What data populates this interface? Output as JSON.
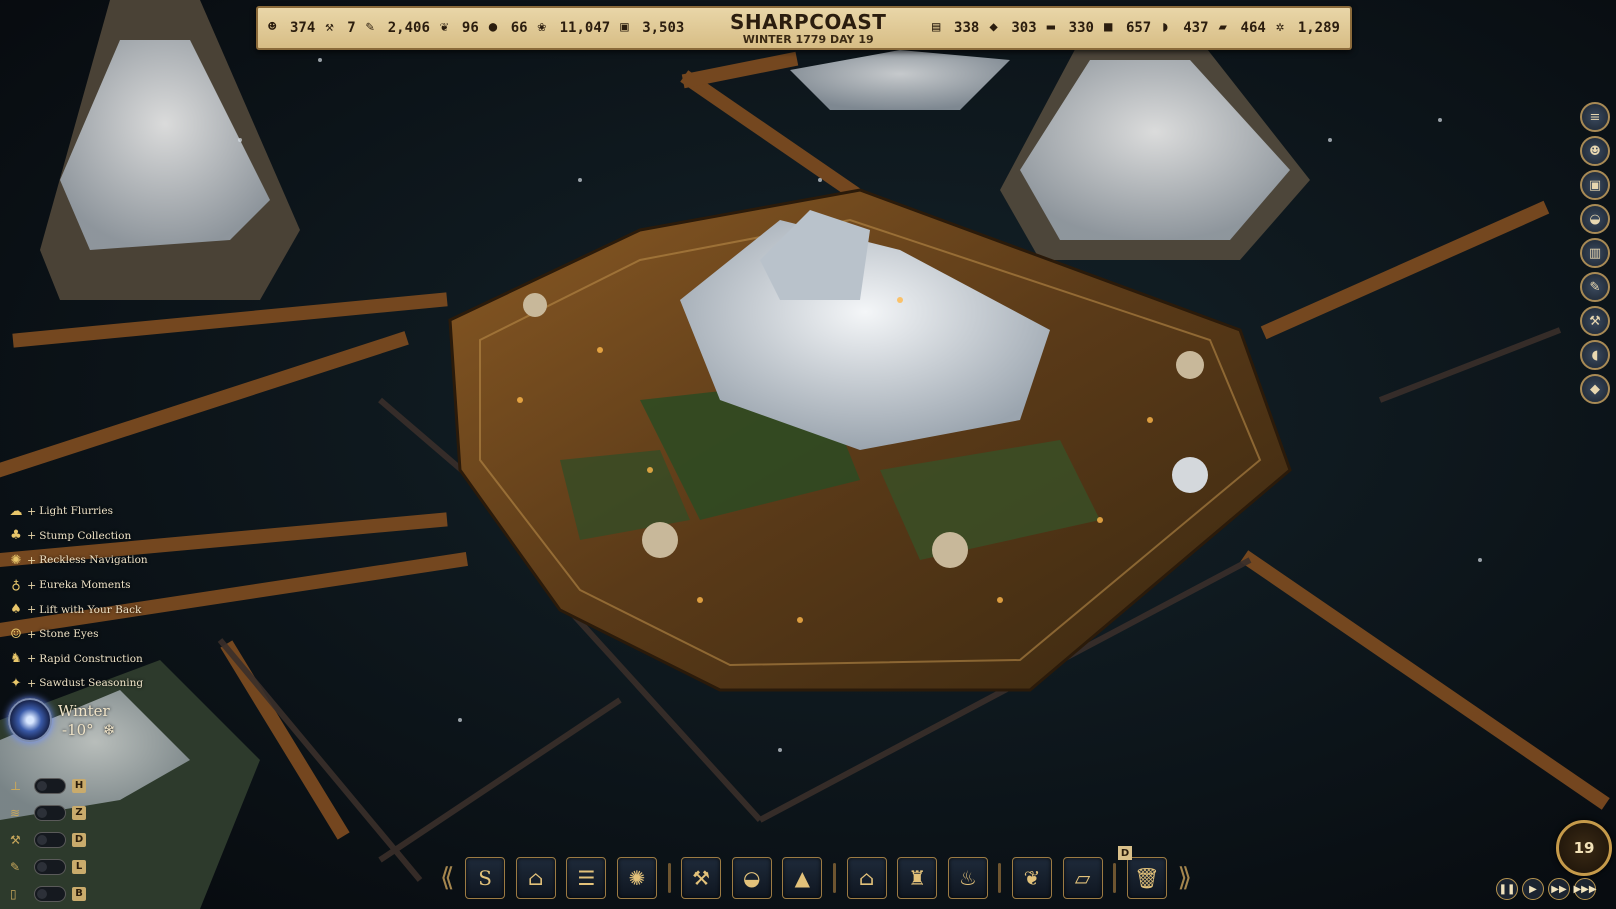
{
  "resources_left": [
    {
      "icon": "population-icon",
      "glyph": "☻",
      "value": "374"
    },
    {
      "icon": "workers-hammer-icon",
      "glyph": "⚒",
      "value": "7"
    },
    {
      "icon": "research-quill-icon",
      "glyph": "✎",
      "value": "2,406"
    },
    {
      "icon": "feather-icon",
      "glyph": "❦",
      "value": "96"
    },
    {
      "icon": "meat-icon",
      "glyph": "●",
      "value": "66"
    },
    {
      "icon": "wood-log-icon",
      "glyph": "❀",
      "value": "11,047"
    },
    {
      "icon": "barrel-icon",
      "glyph": "▣",
      "value": "3,503"
    }
  ],
  "town": {
    "name": "SHARPCOAST",
    "date": "WINTER 1779 DAY 19"
  },
  "resources_right": [
    {
      "icon": "planks-icon",
      "glyph": "▤",
      "value": "338"
    },
    {
      "icon": "stone-icon",
      "glyph": "◆",
      "value": "303"
    },
    {
      "icon": "bricks-icon",
      "glyph": "▬",
      "value": "330"
    },
    {
      "icon": "stone-block-icon",
      "glyph": "■",
      "value": "657"
    },
    {
      "icon": "clay-icon",
      "glyph": "◗",
      "value": "437"
    },
    {
      "icon": "iron-bar-icon",
      "glyph": "▰",
      "value": "464"
    },
    {
      "icon": "gears-icon",
      "glyph": "✲",
      "value": "1,289"
    }
  ],
  "right_sidebar": [
    {
      "name": "menu-icon",
      "glyph": "≡"
    },
    {
      "name": "population-overview-icon",
      "glyph": "☻"
    },
    {
      "name": "storage-crate-icon",
      "glyph": "▣"
    },
    {
      "name": "bread-icon",
      "glyph": "◒"
    },
    {
      "name": "book-icon",
      "glyph": "▥"
    },
    {
      "name": "tools-icon",
      "glyph": "✎"
    },
    {
      "name": "hammer-icon",
      "glyph": "⚒"
    },
    {
      "name": "potion-icon",
      "glyph": "◖"
    },
    {
      "name": "gem-icon",
      "glyph": "◆"
    }
  ],
  "modifiers": [
    {
      "icon": "cloud-snow-icon",
      "glyph": "☁",
      "label": "Light Flurries"
    },
    {
      "icon": "stump-icon",
      "glyph": "♣",
      "label": "Stump Collection"
    },
    {
      "icon": "ship-wheel-icon",
      "glyph": "✺",
      "label": "Reckless Navigation"
    },
    {
      "icon": "flask-icon",
      "glyph": "♁",
      "label": "Eureka Moments"
    },
    {
      "icon": "muscle-arm-icon",
      "glyph": "♠",
      "label": "Lift with Your Back"
    },
    {
      "icon": "cat-face-icon",
      "glyph": "☺",
      "label": "Stone Eyes"
    },
    {
      "icon": "runner-icon",
      "glyph": "♞",
      "label": "Rapid Construction"
    },
    {
      "icon": "sawdust-icon",
      "glyph": "✦",
      "label": "Sawdust Seasoning"
    }
  ],
  "season": {
    "name": "Winter",
    "temperature": "-10°",
    "snow_glyph": "❄"
  },
  "toggles": [
    {
      "icon": "thermometer-icon",
      "glyph": "⊥",
      "key": "H"
    },
    {
      "icon": "layers-icon",
      "glyph": "≋",
      "key": "Z"
    },
    {
      "icon": "pickaxe-icon",
      "glyph": "⚒",
      "key": "D"
    },
    {
      "icon": "shovel-icon",
      "glyph": "✎",
      "key": "L"
    },
    {
      "icon": "trash-icon",
      "glyph": "▯",
      "key": "B"
    }
  ],
  "build_toolbar": [
    {
      "name": "roads-button",
      "glyph": "S",
      "type": "button"
    },
    {
      "name": "warehouse-button",
      "glyph": "⌂",
      "type": "button"
    },
    {
      "name": "ladder-button",
      "glyph": "☰",
      "type": "button"
    },
    {
      "name": "ship-wheel-button",
      "glyph": "✺",
      "type": "button"
    },
    {
      "type": "sep"
    },
    {
      "name": "tools-button",
      "glyph": "⚒",
      "type": "button"
    },
    {
      "name": "food-button",
      "glyph": "◒",
      "type": "button"
    },
    {
      "name": "industry-button",
      "glyph": "▲",
      "type": "button"
    },
    {
      "type": "sep"
    },
    {
      "name": "housing-button",
      "glyph": "⌂",
      "type": "button"
    },
    {
      "name": "civic-button",
      "glyph": "♜",
      "type": "button"
    },
    {
      "name": "fountain-button",
      "glyph": "♨",
      "type": "button"
    },
    {
      "type": "sep"
    },
    {
      "name": "farming-button",
      "glyph": "❦",
      "type": "button"
    },
    {
      "name": "blueprint-button",
      "glyph": "▱",
      "type": "button"
    },
    {
      "type": "sep"
    },
    {
      "name": "delete-button",
      "glyph": "🗑",
      "type": "button"
    }
  ],
  "delete_hotkey": "D",
  "speed": {
    "value": "19",
    "pause": "❚❚",
    "play": "▶",
    "fast": "▶▶",
    "fastest": "▶▶▶"
  }
}
